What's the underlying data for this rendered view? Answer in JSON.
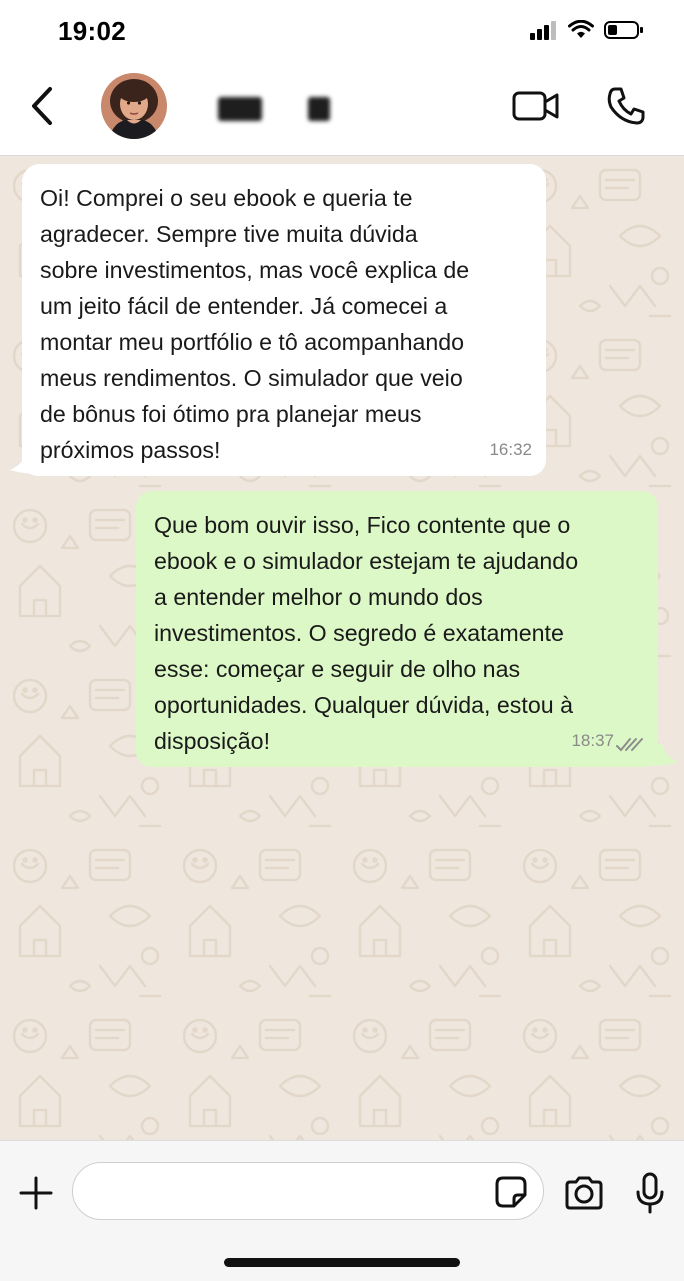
{
  "status_bar": {
    "time": "19:02"
  },
  "contact": {
    "name_redacted": true
  },
  "messages": [
    {
      "direction": "incoming",
      "text": "Oi! Comprei o seu ebook e queria te\nagradecer. Sempre tive muita dúvida\nsobre investimentos, mas você explica de\num jeito fácil de entender. Já comecei a\nmontar meu portfólio e tô acompanhando\nmeus rendimentos. O simulador que veio\nde bônus foi ótimo pra planejar meus\npróximos passos!",
      "time": "16:32"
    },
    {
      "direction": "outgoing",
      "text": "Que bom ouvir isso, Fico contente que o\nebook e o simulador estejam te ajudando\na entender melhor o mundo dos\ninvestimentos. O segredo é exatamente\nesse: começar e seguir de olho nas\noportunidades. Qualquer dúvida, estou à\ndisposição!",
      "time": "18:37",
      "status": "read"
    }
  ],
  "composer": {
    "value": "",
    "placeholder": ""
  },
  "icons": {
    "back": "chevron-left-icon",
    "video_call": "video-camera-icon",
    "voice_call": "phone-icon",
    "attach": "plus-icon",
    "sticker": "sticker-icon",
    "camera": "camera-icon",
    "mic": "microphone-icon"
  },
  "colors": {
    "chat_background": "#efe7de",
    "incoming_bubble": "#ffffff",
    "outgoing_bubble": "#dcf8c6",
    "timestamp": "#8a8a8a",
    "read_ticks": "#8c8c8c"
  }
}
